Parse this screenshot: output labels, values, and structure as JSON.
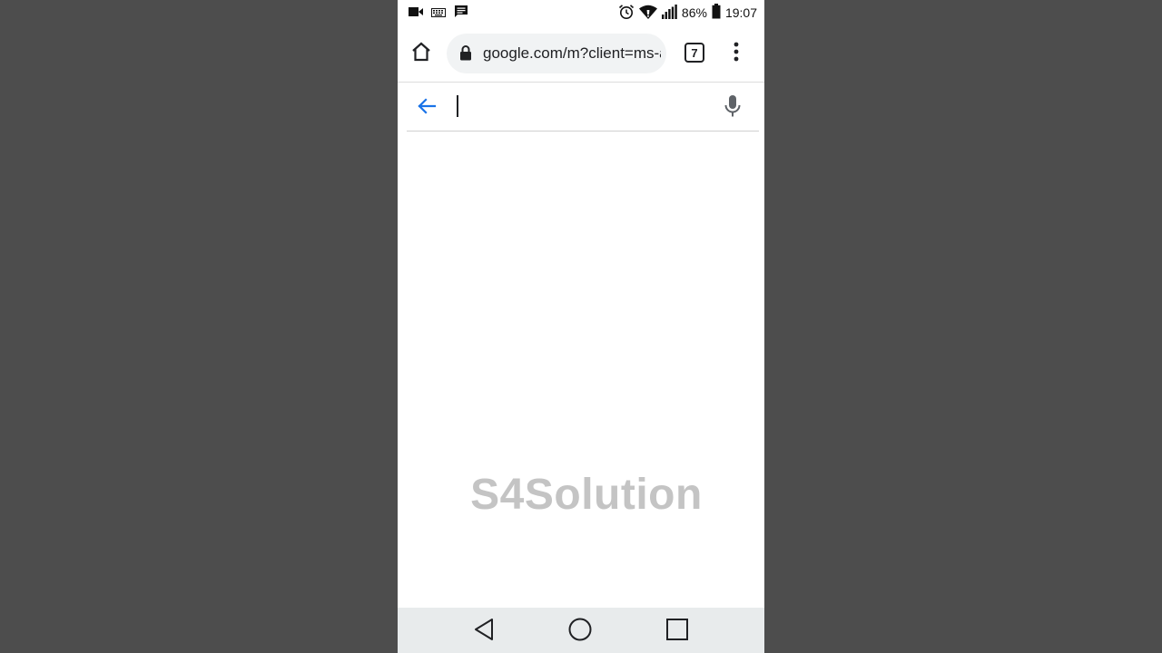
{
  "status_bar": {
    "left_icons": [
      "video-camera-icon",
      "keyboard-icon",
      "message-icon"
    ],
    "right_icons": [
      "alarm-icon",
      "wifi-icon",
      "cell-signal-icon",
      "battery-icon"
    ],
    "battery_percent": "86%",
    "time": "19:07"
  },
  "browser": {
    "url": "google.com/m?client=ms-android",
    "tab_count": "7",
    "icons": {
      "home": "home-icon",
      "lock": "lock-icon",
      "menu": "more-vert-icon"
    }
  },
  "search": {
    "value": "",
    "placeholder": "",
    "icons": {
      "back": "arrow-left-icon",
      "mic": "microphone-icon"
    },
    "accent_color": "#1a73e8"
  },
  "watermark": {
    "text": "S4Solution"
  },
  "nav_bar": {
    "icons": [
      "back-triangle-icon",
      "home-circle-icon",
      "recents-square-icon"
    ]
  }
}
